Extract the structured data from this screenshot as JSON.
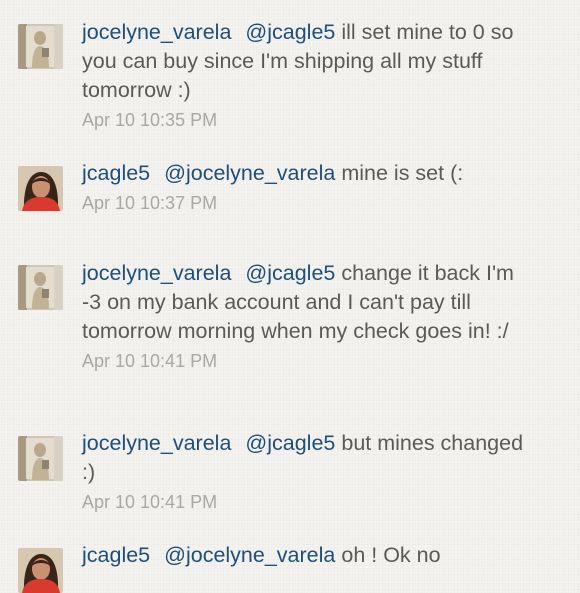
{
  "comments": [
    {
      "username": "jocelyne_varela",
      "mention": "@jcagle5",
      "text": "ill set mine to 0 so you can buy since I'm shipping all my stuff tomorrow :)",
      "timestamp": "Apr 10 10:35 PM",
      "avatar": "mirror-selfie-avatar"
    },
    {
      "username": "jcagle5",
      "mention": "@jocelyne_varela",
      "text": "mine is set (:",
      "timestamp": "Apr 10 10:37 PM",
      "avatar": "portrait-avatar"
    },
    {
      "username": "jocelyne_varela",
      "mention": "@jcagle5",
      "text": "change it back I'm -3 on my bank account and I can't pay till tomorrow morning when my check goes in! :/",
      "timestamp": "Apr 10 10:41 PM",
      "avatar": "mirror-selfie-avatar"
    },
    {
      "username": "jocelyne_varela",
      "mention": "@jcagle5",
      "text": "but mines changed :)",
      "timestamp": "Apr 10 10:41 PM",
      "avatar": "mirror-selfie-avatar"
    },
    {
      "username": "jcagle5",
      "mention": "@jocelyne_varela",
      "text": "oh ! Ok no",
      "timestamp": "",
      "avatar": "portrait-avatar"
    }
  ]
}
